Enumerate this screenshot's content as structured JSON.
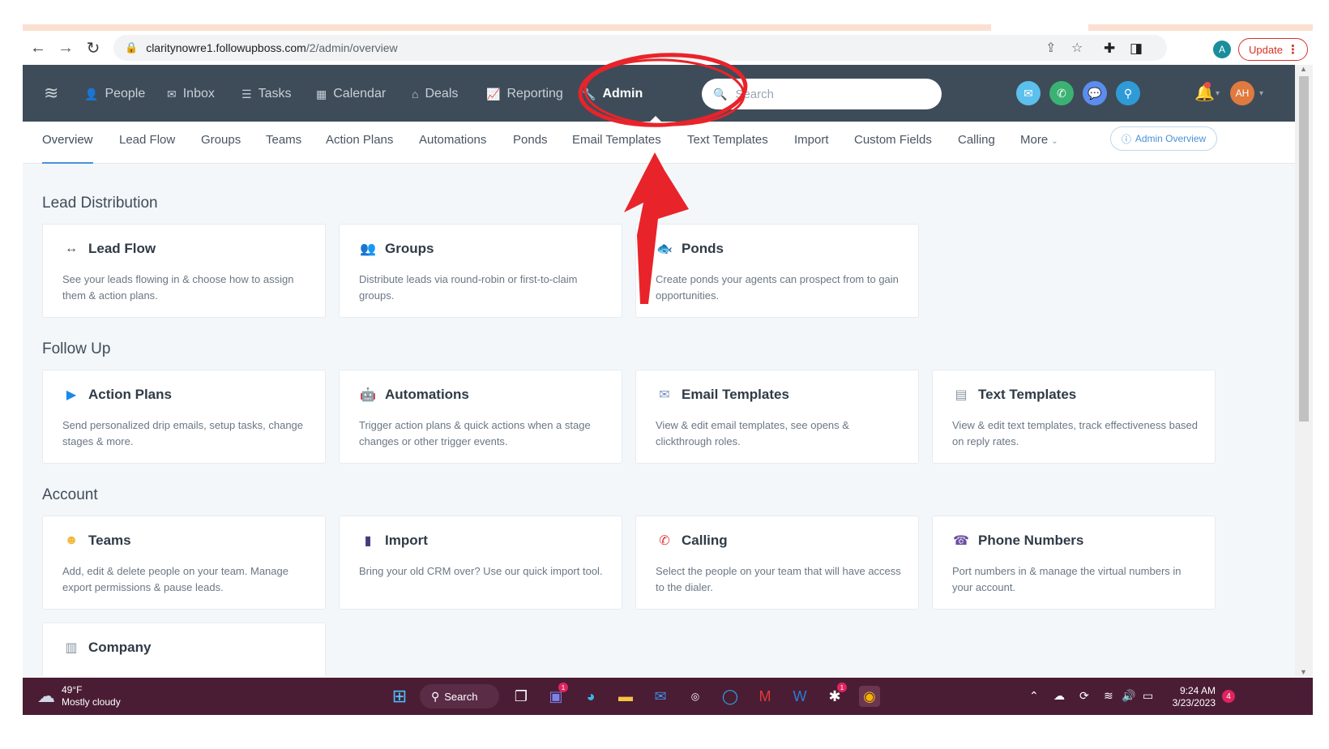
{
  "browser": {
    "url_host": "claritynowre1.followupboss.com",
    "url_path": "/2/admin/overview",
    "profile_initial": "A",
    "update_label": "Update"
  },
  "nav": {
    "items": [
      {
        "label": "People",
        "icon": "person-icon"
      },
      {
        "label": "Inbox",
        "icon": "inbox-icon"
      },
      {
        "label": "Tasks",
        "icon": "tasks-icon"
      },
      {
        "label": "Calendar",
        "icon": "calendar-icon"
      },
      {
        "label": "Deals",
        "icon": "deals-icon"
      },
      {
        "label": "Reporting",
        "icon": "chart-icon"
      },
      {
        "label": "Admin",
        "icon": "wrench-icon"
      }
    ],
    "active": "Admin",
    "search_placeholder": "Search",
    "avatar_initials": "AH"
  },
  "subnav": {
    "items": [
      "Overview",
      "Lead Flow",
      "Groups",
      "Teams",
      "Action Plans",
      "Automations",
      "Ponds",
      "Email Templates",
      "Text Templates",
      "Import",
      "Custom Fields",
      "Calling",
      "More"
    ],
    "active": "Overview",
    "admin_overview_label": "Admin Overview"
  },
  "sections": [
    {
      "title": "Lead Distribution",
      "cards": [
        {
          "title": "Lead Flow",
          "icon": "arrows-icon",
          "desc": "See your leads flowing in & choose how to assign them & action plans."
        },
        {
          "title": "Groups",
          "icon": "groups-icon",
          "desc": "Distribute leads via round-robin or first-to-claim groups."
        },
        {
          "title": "Ponds",
          "icon": "fish-icon",
          "desc": "Create ponds your agents can prospect from to gain opportunities."
        }
      ]
    },
    {
      "title": "Follow Up",
      "cards": [
        {
          "title": "Action Plans",
          "icon": "play-icon",
          "desc": "Send personalized drip emails, setup tasks, change stages & more."
        },
        {
          "title": "Automations",
          "icon": "robot-icon",
          "desc": "Trigger action plans & quick actions when a stage changes or other trigger events."
        },
        {
          "title": "Email Templates",
          "icon": "email-icon",
          "desc": "View & edit email templates, see opens & clickthrough roles."
        },
        {
          "title": "Text Templates",
          "icon": "document-icon",
          "desc": "View & edit text templates, track effectiveness based on reply rates."
        }
      ]
    },
    {
      "title": "Account",
      "cards": [
        {
          "title": "Teams",
          "icon": "team-icon",
          "desc": "Add, edit & delete people on your team. Manage export permissions & pause leads."
        },
        {
          "title": "Import",
          "icon": "import-icon",
          "desc": "Bring your old CRM over? Use our quick import tool."
        },
        {
          "title": "Calling",
          "icon": "phone-icon",
          "desc": "Select the people on your team that will have access to the dialer."
        },
        {
          "title": "Phone Numbers",
          "icon": "phone-numbers-icon",
          "desc": "Port numbers in & manage the virtual numbers in your account."
        }
      ]
    },
    {
      "title": "",
      "cards": [
        {
          "title": "Company",
          "icon": "building-icon",
          "desc": ""
        }
      ]
    }
  ],
  "taskbar": {
    "temperature": "49°F",
    "weather": "Mostly cloudy",
    "search_label": "Search",
    "time": "9:24 AM",
    "date": "3/23/2023",
    "notification_count": "4",
    "teams_badge": "1",
    "slack_badge": "1"
  },
  "colors": {
    "nav_bg": "#3e4c59",
    "content_bg": "#f4f7fa",
    "accent": "#4a90d9",
    "annotation": "#e8242a",
    "taskbar_bg": "#4a1d35"
  }
}
